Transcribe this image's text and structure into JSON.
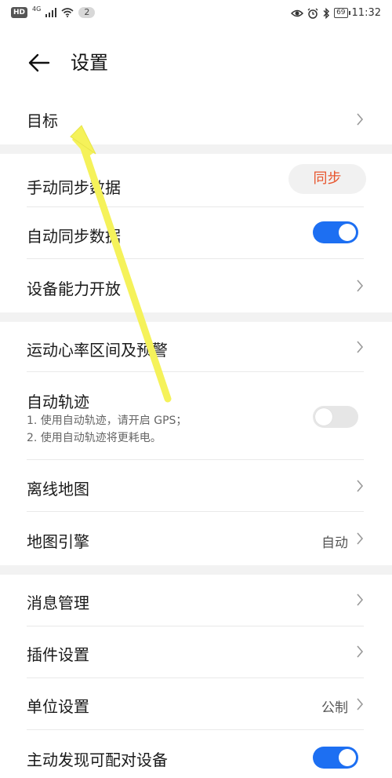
{
  "status_bar": {
    "hd": "HD",
    "network": "4G",
    "notification_count": "2",
    "battery": "69",
    "time": "11:32"
  },
  "header": {
    "title": "设置"
  },
  "rows": {
    "goal": {
      "label": "目标"
    },
    "manual_sync": {
      "label": "手动同步数据",
      "button": "同步"
    },
    "auto_sync": {
      "label": "自动同步数据",
      "toggle": true
    },
    "device_capability": {
      "label": "设备能力开放"
    },
    "heart_rate": {
      "label": "运动心率区间及预警"
    },
    "auto_track": {
      "label": "自动轨迹",
      "desc1": "1. 使用自动轨迹，请开启 GPS；",
      "desc2": "2. 使用自动轨迹将更耗电。",
      "toggle": false
    },
    "offline_map": {
      "label": "离线地图"
    },
    "map_engine": {
      "label": "地图引擎",
      "value": "自动"
    },
    "message_mgmt": {
      "label": "消息管理"
    },
    "plugin_settings": {
      "label": "插件设置"
    },
    "unit_settings": {
      "label": "单位设置",
      "value": "公制"
    },
    "discover_devices": {
      "label": "主动发现可配对设备",
      "toggle": true
    }
  },
  "colors": {
    "accent": "#1d6ff2",
    "sync_text": "#e8552d",
    "section_gap": "#f2f2f2",
    "annotation_arrow": "#f5f25a"
  }
}
